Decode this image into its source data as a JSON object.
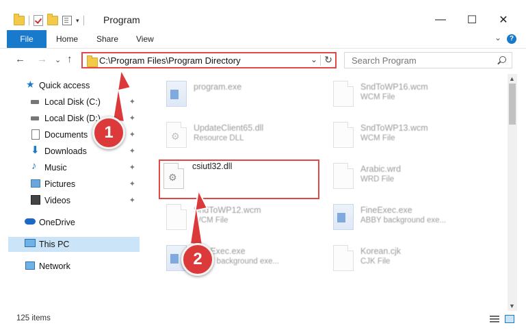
{
  "window": {
    "title": "Program",
    "minimize": "—",
    "maximize": "☐",
    "close": "✕"
  },
  "qat": {
    "dropdown": "▾"
  },
  "ribbon": {
    "tabs": [
      "File",
      "Home",
      "Share",
      "View"
    ],
    "collapse": "⌄",
    "help": "?"
  },
  "nav": {
    "back": "←",
    "forward": "→",
    "recent": "⌄",
    "up": "↑",
    "address": "C:\\Program Files\\Program Directory",
    "address_dropdown": "⌄",
    "refresh": "↻",
    "search_placeholder": "Search Program"
  },
  "sidebar": {
    "items": [
      {
        "label": "Quick access",
        "icon": "star-icon",
        "pinned": false
      },
      {
        "label": "Local Disk (C:)",
        "icon": "drive-icon",
        "pinned": true
      },
      {
        "label": "Local Disk (D:)",
        "icon": "drive-icon",
        "pinned": true
      },
      {
        "label": "Documents",
        "icon": "documents-icon",
        "pinned": true
      },
      {
        "label": "Downloads",
        "icon": "download-icon",
        "pinned": true
      },
      {
        "label": "Music",
        "icon": "music-icon",
        "pinned": true
      },
      {
        "label": "Pictures",
        "icon": "pictures-icon",
        "pinned": true
      },
      {
        "label": "Videos",
        "icon": "videos-icon",
        "pinned": true
      },
      {
        "label": "OneDrive",
        "icon": "cloud-icon",
        "pinned": false
      },
      {
        "label": "This PC",
        "icon": "computer-icon",
        "pinned": false
      },
      {
        "label": "Network",
        "icon": "network-icon",
        "pinned": false
      }
    ],
    "pin_glyph": "📌"
  },
  "files": [
    {
      "name": "program.exe",
      "type": "",
      "icon": "app-icon"
    },
    {
      "name": "SndToWP16.wcm",
      "type": "WCM File",
      "icon": "file-icon"
    },
    {
      "name": "UpdateClient65.dll",
      "type": "Resource DLL",
      "icon": "gear-file-icon"
    },
    {
      "name": "SndToWP13.wcm",
      "type": "WCM File",
      "icon": "file-icon"
    },
    {
      "name": "csiutl32.dll",
      "type": "",
      "icon": "gear-file-icon"
    },
    {
      "name": "Arabic.wrd",
      "type": "WRD File",
      "icon": "file-icon"
    },
    {
      "name": "SndToWP12.wcm",
      "type": "WCM File",
      "icon": "file-icon"
    },
    {
      "name": "FineExec.exe",
      "type": "ABBY background exe...",
      "icon": "app-icon"
    },
    {
      "name": "FineExec.exe",
      "type": "ABBY background exe...",
      "icon": "app-icon"
    },
    {
      "name": "Korean.cjk",
      "type": "CJK File",
      "icon": "file-icon"
    }
  ],
  "callouts": [
    "1",
    "2"
  ],
  "status": {
    "count": "125 items"
  },
  "colors": {
    "accent": "#1979ca",
    "highlight": "#e04848",
    "selected": "#cce4f7"
  }
}
